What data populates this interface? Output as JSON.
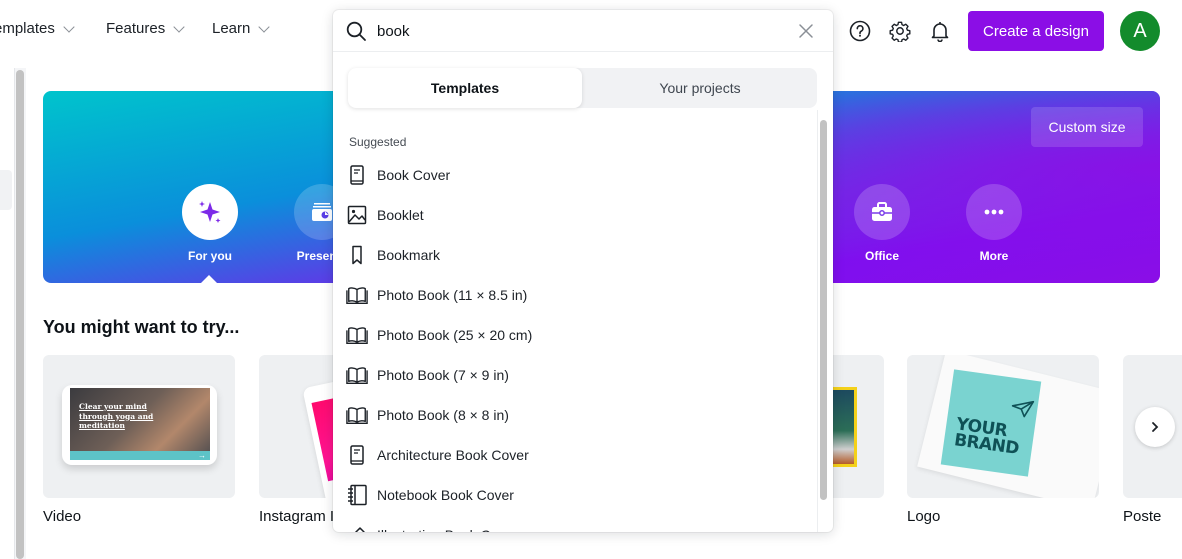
{
  "nav": {
    "items": [
      {
        "label": "emplates",
        "name": "templates"
      },
      {
        "label": "Features",
        "name": "features"
      },
      {
        "label": "Learn",
        "name": "learn"
      }
    ],
    "create_label": "Create a design",
    "avatar_initial": "A",
    "icons": [
      "help-icon",
      "gear-icon",
      "bell-icon"
    ]
  },
  "search": {
    "value": "book",
    "tabs": [
      {
        "label": "Templates",
        "active": true
      },
      {
        "label": "Your projects",
        "active": false
      }
    ],
    "suggested_heading": "Suggested",
    "suggestions": [
      {
        "label": "Book Cover",
        "icon": "book-cover-icon"
      },
      {
        "label": "Booklet",
        "icon": "image-icon"
      },
      {
        "label": "Bookmark",
        "icon": "bookmark-icon"
      },
      {
        "label": "Photo Book (11 × 8.5 in)",
        "icon": "open-book-icon"
      },
      {
        "label": "Photo Book (25 × 20 cm)",
        "icon": "open-book-icon"
      },
      {
        "label": "Photo Book (7 × 9 in)",
        "icon": "open-book-icon"
      },
      {
        "label": "Photo Book (8 × 8 in)",
        "icon": "open-book-icon"
      },
      {
        "label": "Architecture Book Cover",
        "icon": "book-cover-icon"
      },
      {
        "label": "Notebook Book Cover",
        "icon": "notebook-icon"
      },
      {
        "label": "Illustration Book Cover",
        "icon": "pen-icon"
      }
    ]
  },
  "hero": {
    "custom_size_label": "Custom size",
    "categories": [
      {
        "label": "For you",
        "icon": "sparkle-icon",
        "active": true
      },
      {
        "label": "Presenta",
        "icon": "presentation-icon",
        "active": false
      },
      {
        "label": "Office",
        "icon": "briefcase-icon",
        "active": false
      },
      {
        "label": "More",
        "icon": "more-icon",
        "active": false
      }
    ]
  },
  "try_section": {
    "title": "You might want to try...",
    "cards": [
      {
        "label": "Video",
        "thumb_text": "Clear your mind through yoga and meditation"
      },
      {
        "label": "Instagram I"
      },
      {
        "label": ""
      },
      {
        "label": "Logo",
        "thumb_text": "YOUR BRAND"
      },
      {
        "label": "Poste"
      }
    ]
  },
  "colors": {
    "brand_purple": "#8b0ee6",
    "avatar_green": "#138b2c",
    "hero_start": "#00c4cc",
    "hero_end": "#8b0ee6"
  }
}
